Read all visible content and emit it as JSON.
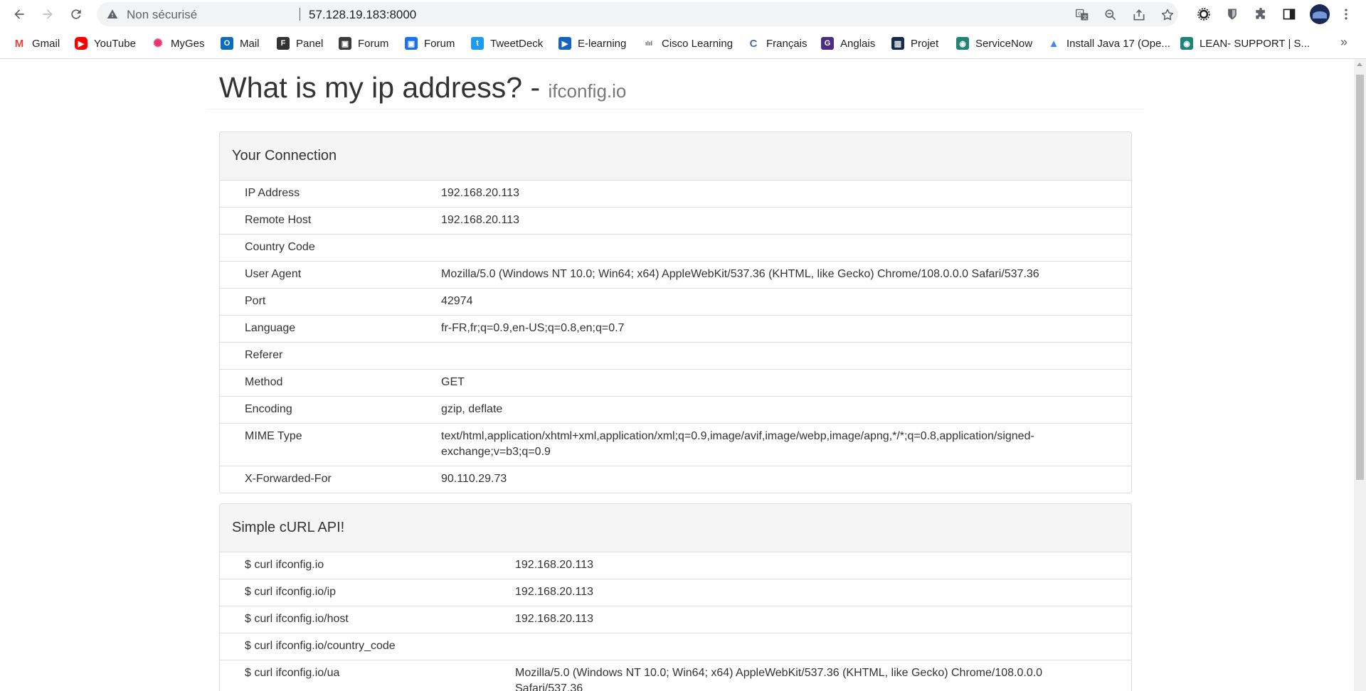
{
  "browser": {
    "security_label": "Non sécurisé",
    "url": "57.128.19.183:8000",
    "bookmarks": [
      {
        "label": "Gmail",
        "icon": "gmail-icon",
        "color": "#ea4335"
      },
      {
        "label": "YouTube",
        "icon": "youtube-icon",
        "color": "#ff0000"
      },
      {
        "label": "MyGes",
        "icon": "myges-icon",
        "color": "#e8336d"
      },
      {
        "label": "Mail",
        "icon": "outlook-icon",
        "color": "#0f6cbd"
      },
      {
        "label": "Panel",
        "icon": "panel-icon",
        "color": "#333333"
      },
      {
        "label": "Forum",
        "icon": "forum-icon",
        "color": "#3c3c3c"
      },
      {
        "label": "Forum",
        "icon": "forum-icon",
        "color": "#1a73e8"
      },
      {
        "label": "TweetDeck",
        "icon": "twitter-icon",
        "color": "#1d9bf0"
      },
      {
        "label": "E-learning",
        "icon": "elearning-icon",
        "color": "#1565c0"
      },
      {
        "label": "Cisco Learning",
        "icon": "cisco-icon",
        "color": "#5f6368"
      },
      {
        "label": "Français",
        "icon": "francais-icon",
        "color": "#4a6fa5"
      },
      {
        "label": "Anglais",
        "icon": "anglais-icon",
        "color": "#4b2d83"
      },
      {
        "label": "Projet",
        "icon": "trello-icon",
        "color": "#172b4d"
      },
      {
        "label": "ServiceNow",
        "icon": "servicenow-icon",
        "color": "#1f8476"
      },
      {
        "label": "Install Java 17 (Ope...",
        "icon": "java-icon",
        "color": "#4285f4"
      },
      {
        "label": "LEAN- SUPPORT | S...",
        "icon": "lean-support-icon",
        "color": "#1f8476"
      }
    ],
    "more_label": "»"
  },
  "page": {
    "title": "What is my ip address? - ",
    "title_small": "ifconfig.io"
  },
  "connection": {
    "heading": "Your Connection",
    "rows": [
      {
        "key": "IP Address",
        "value": "192.168.20.113"
      },
      {
        "key": "Remote Host",
        "value": "192.168.20.113"
      },
      {
        "key": "Country Code",
        "value": ""
      },
      {
        "key": "User Agent",
        "value": "Mozilla/5.0 (Windows NT 10.0; Win64; x64) AppleWebKit/537.36 (KHTML, like Gecko) Chrome/108.0.0.0 Safari/537.36"
      },
      {
        "key": "Port",
        "value": "42974"
      },
      {
        "key": "Language",
        "value": "fr-FR,fr;q=0.9,en-US;q=0.8,en;q=0.7"
      },
      {
        "key": "Referer",
        "value": ""
      },
      {
        "key": "Method",
        "value": "GET"
      },
      {
        "key": "Encoding",
        "value": "gzip, deflate"
      },
      {
        "key": "MIME Type",
        "value": "text/html,application/xhtml+xml,application/xml;q=0.9,image/avif,image/webp,image/apng,*/*;q=0.8,application/signed-exchange;v=b3;q=0.9"
      },
      {
        "key": "X-Forwarded-For",
        "value": "90.110.29.73"
      }
    ]
  },
  "curl": {
    "heading": "Simple cURL API!",
    "rows": [
      {
        "key": "$ curl ifconfig.io",
        "value": "192.168.20.113"
      },
      {
        "key": "$ curl ifconfig.io/ip",
        "value": "192.168.20.113"
      },
      {
        "key": "$ curl ifconfig.io/host",
        "value": "192.168.20.113"
      },
      {
        "key": "$ curl ifconfig.io/country_code",
        "value": ""
      },
      {
        "key": "$ curl ifconfig.io/ua",
        "value": "Mozilla/5.0 (Windows NT 10.0; Win64; x64) AppleWebKit/537.36 (KHTML, like Gecko) Chrome/108.0.0.0 Safari/537.36"
      }
    ]
  }
}
